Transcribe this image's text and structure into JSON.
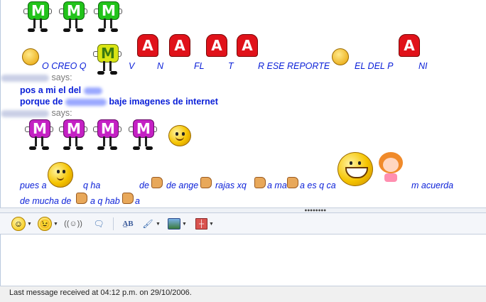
{
  "chat": {
    "line1": {
      "segments": [
        "O CREO Q",
        "V",
        "N",
        "FL",
        "T",
        "R ESE REPORTE",
        "EL DEL P",
        "NI"
      ],
      "letters": [
        "M",
        "A",
        "A",
        "A",
        "A",
        "A"
      ]
    },
    "message1": {
      "says": "says:",
      "lines": [
        "pos a mi el del",
        "porque de",
        "baje imagenes de internet"
      ]
    },
    "message2": {
      "says": "says:",
      "letters": [
        "M",
        "M",
        "M",
        "M"
      ],
      "line_a": [
        "pues a",
        "q ha",
        "de",
        "de ange",
        "rajas xq",
        "a ma",
        "a es q ca",
        "m acuerda"
      ],
      "line_b": [
        "de mucha de",
        "a q hab",
        "a"
      ]
    },
    "top_letters": [
      "M",
      "M",
      "M"
    ]
  },
  "toolbar": {
    "icons": [
      "emoticon-icon",
      "wink-icon",
      "nudge-icon",
      "voice-clip-icon",
      "font-icon",
      "color-icon",
      "background-icon",
      "gift-icon"
    ]
  },
  "status": {
    "text": "Last message received at 04:12 p.m. on 29/10/2006."
  }
}
